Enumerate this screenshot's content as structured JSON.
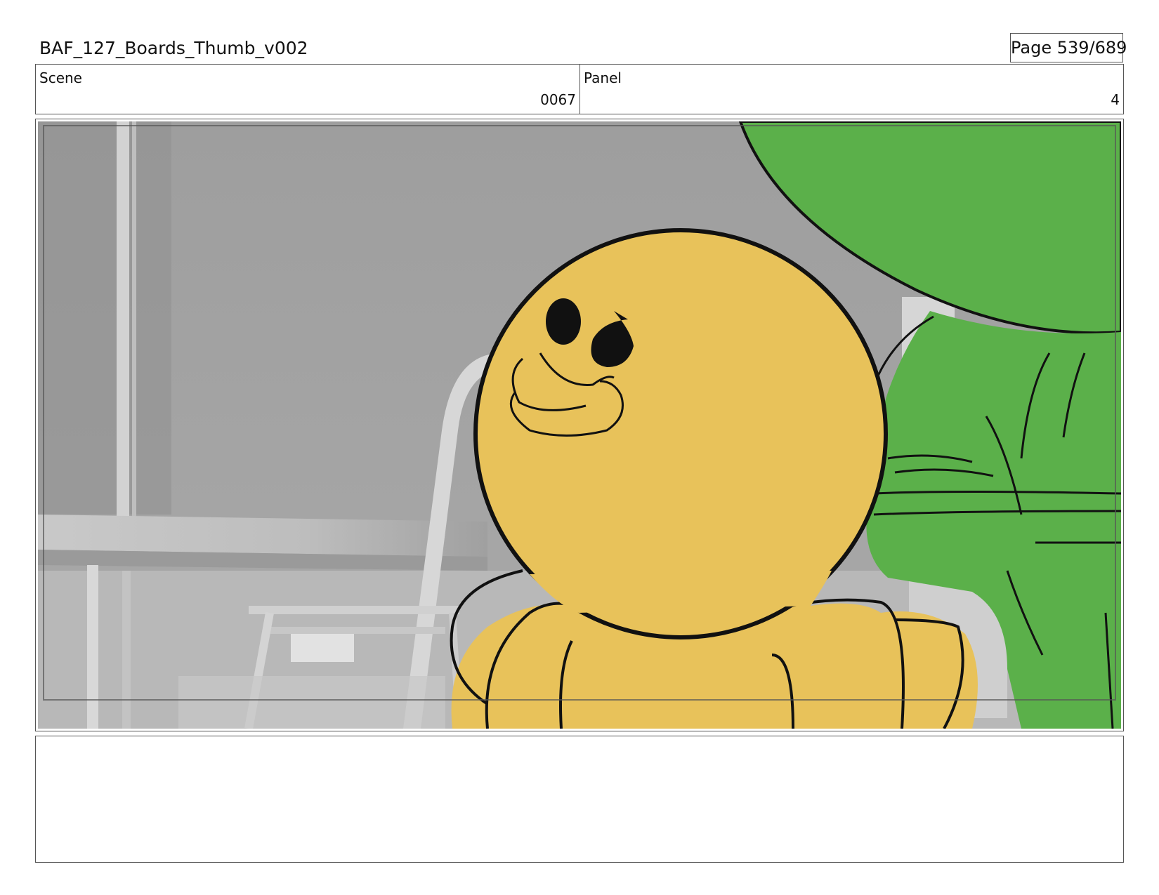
{
  "header": {
    "title": "BAF_127_Boards_Thumb_v002",
    "page": "Page 539/689"
  },
  "info": {
    "scene_label": "Scene",
    "scene_value": "0067",
    "panel_label": "Panel",
    "panel_value": "4"
  },
  "frame": {
    "description_icons": [
      "background-cafe-table",
      "background-chair",
      "yellow-character",
      "green-character"
    ],
    "colors": {
      "character_yellow": "#E8C25A",
      "character_green": "#5BB04A",
      "background_gray": "#A3A3A3"
    }
  },
  "notes": {
    "text": ""
  }
}
